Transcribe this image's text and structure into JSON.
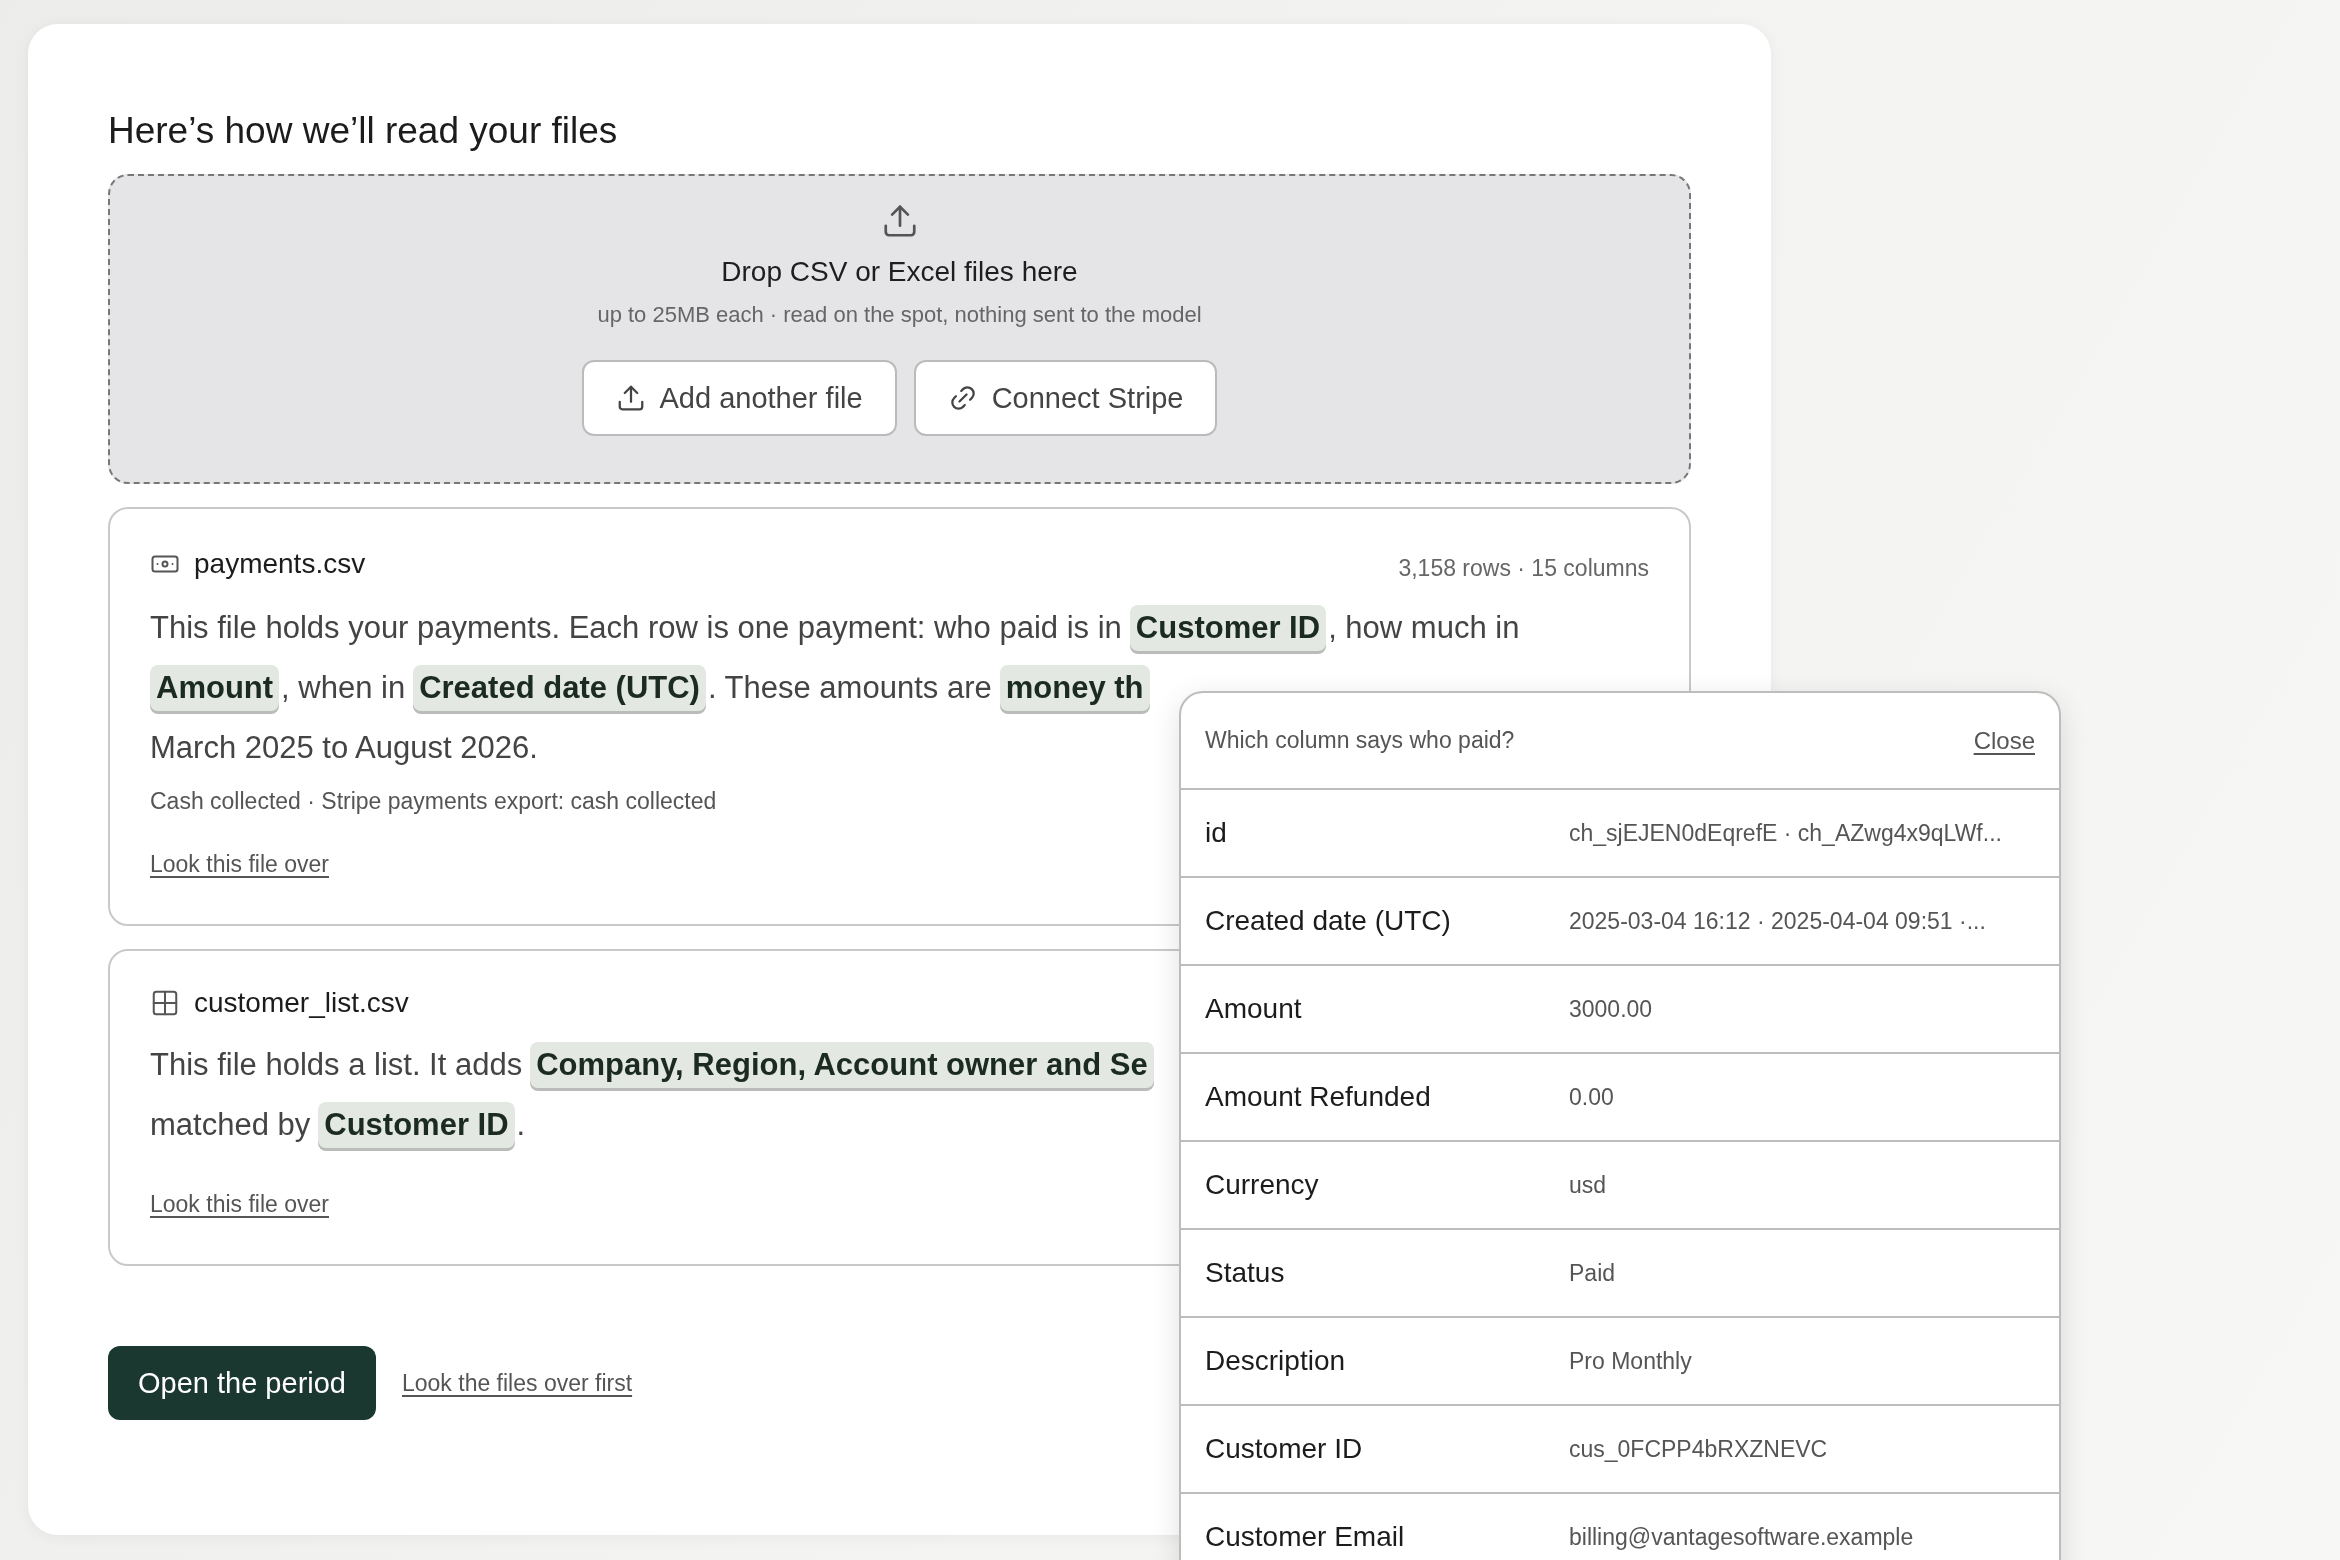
{
  "heading": "Here’s how we’ll read your files",
  "dropzone": {
    "title": "Drop CSV or Excel files here",
    "hint": "up to 25MB each · read on the spot, nothing sent to the model",
    "buttons": [
      {
        "label": "Add another file",
        "kind": "upload"
      },
      {
        "label": "Connect Stripe",
        "kind": "connect"
      }
    ]
  },
  "files": [
    {
      "name": "payments.csv",
      "kind": "payments",
      "meta": "3,158 rows · 15 columns",
      "lines": [
        [
          {
            "kind": "plain",
            "text": "This file holds your payments. Each row is one payment: who paid is in"
          },
          {
            "kind": "chip",
            "text": "Customer ID"
          },
          {
            "kind": "plain",
            "text": ", how much in"
          }
        ],
        [
          {
            "kind": "chip",
            "text": "Amount"
          },
          {
            "kind": "plain",
            "text": ", when in"
          },
          {
            "kind": "chip",
            "text": "Created date (UTC)"
          },
          {
            "kind": "plain",
            "text": ". These amounts are"
          },
          {
            "kind": "chip",
            "text": "money th"
          }
        ],
        [
          {
            "kind": "plain",
            "text": "March 2025 to August 2026."
          }
        ]
      ],
      "note": "Cash collected · Stripe payments export: cash collected",
      "link": "Look this file over"
    },
    {
      "name": "customer_list.csv",
      "kind": "list",
      "lines": [
        [
          {
            "kind": "plain",
            "text": "This file holds a list. It adds"
          },
          {
            "kind": "chip",
            "text": "Company, Region, Account owner and Se"
          }
        ],
        [
          {
            "kind": "plain",
            "text": "matched by"
          },
          {
            "kind": "chip",
            "text": "Customer ID"
          },
          {
            "kind": "plain",
            "text": "."
          }
        ]
      ],
      "link": "Look this file over"
    }
  ],
  "actions": {
    "primary": "Open the period",
    "secondary": "Look the files over first"
  },
  "popover": {
    "question": "Which column says who paid?",
    "close": "Close",
    "rows": [
      {
        "label": "id",
        "value": "ch_sjEJEN0dEqrefE · ch_AZwg4x9qLWf..."
      },
      {
        "label": "Created date (UTC)",
        "value": "2025-03-04 16:12 · 2025-04-04 09:51 ·..."
      },
      {
        "label": "Amount",
        "value": "3000.00"
      },
      {
        "label": "Amount Refunded",
        "value": "0.00"
      },
      {
        "label": "Currency",
        "value": "usd"
      },
      {
        "label": "Status",
        "value": "Paid"
      },
      {
        "label": "Description",
        "value": "Pro Monthly"
      },
      {
        "label": "Customer ID",
        "value": "cus_0FCPP4bRXZNEVC"
      },
      {
        "label": "Customer Email",
        "value": "billing@vantagesoftware.example"
      }
    ]
  }
}
